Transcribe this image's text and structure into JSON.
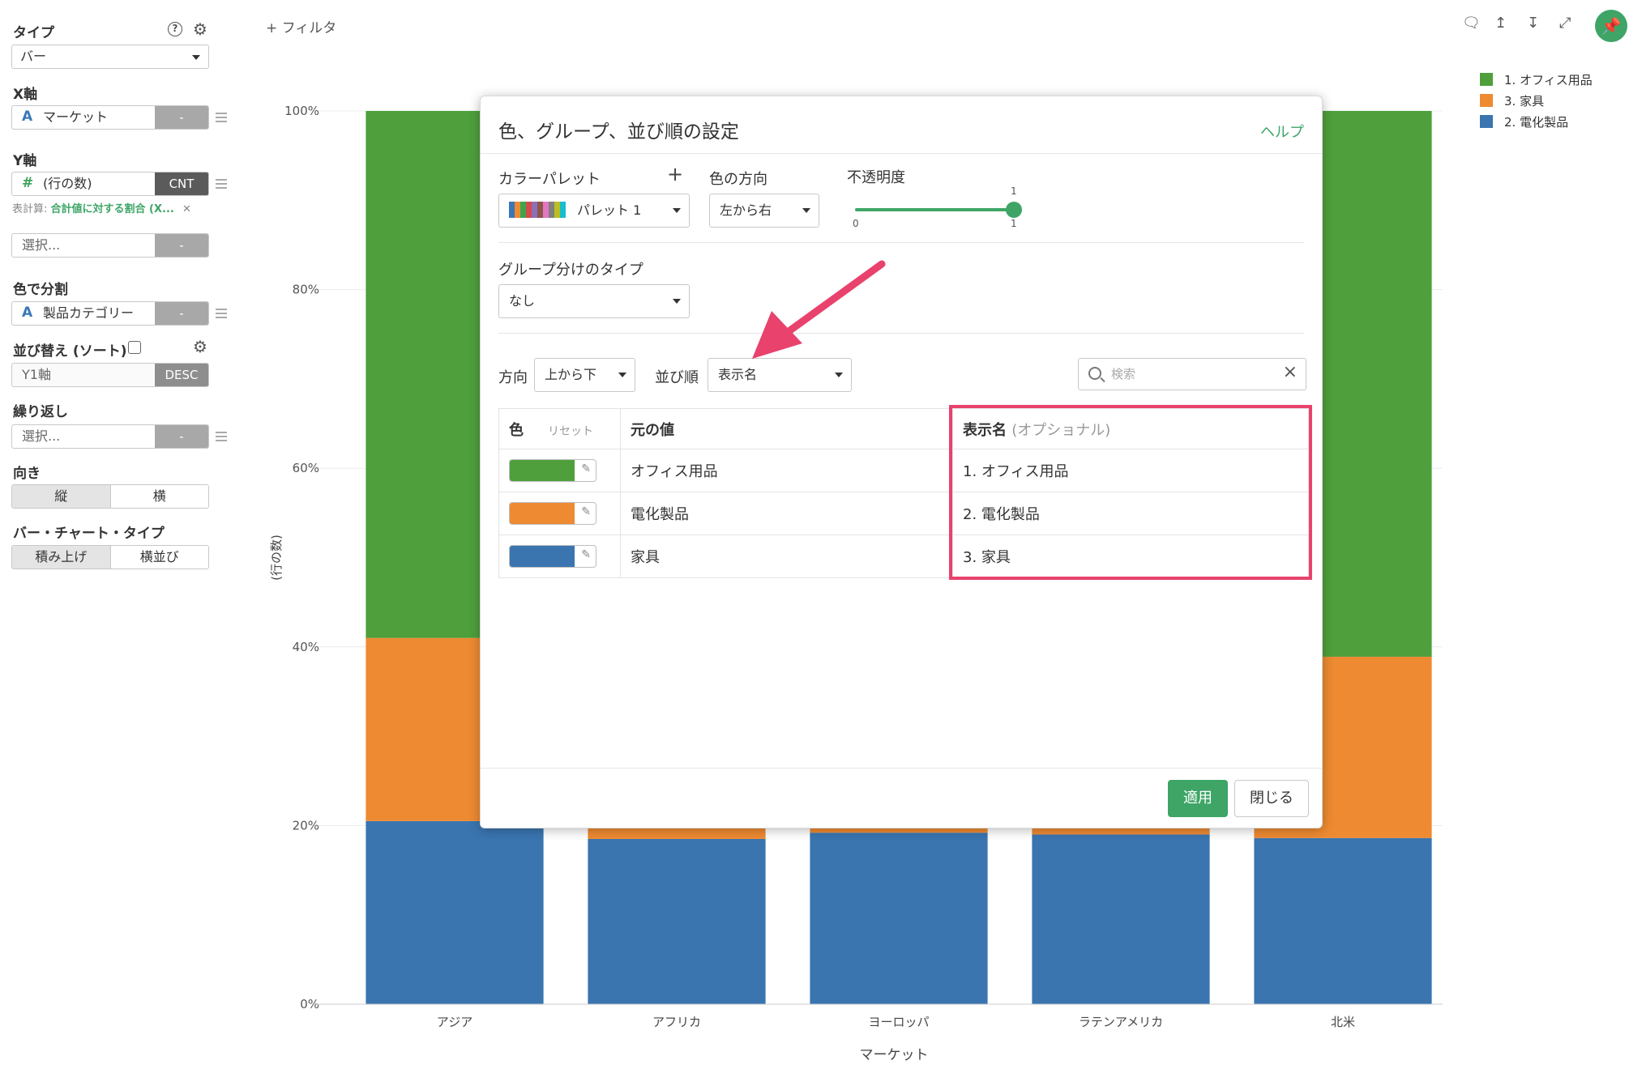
{
  "sidebar": {
    "type_label": "タイプ",
    "type_value": "バー",
    "x_label": "X軸",
    "x_field": {
      "type": "A",
      "name": "マーケット",
      "btn": "-"
    },
    "y_label": "Y軸",
    "y_field": {
      "type": "#",
      "name": "(行の数)",
      "btn": "CNT"
    },
    "table_calc_prefix": "表計算:",
    "table_calc_value": "合計値に対する割合 (X...",
    "y2_placeholder": "選択...",
    "y2_btn": "-",
    "color_label": "色で分割",
    "color_field": {
      "type": "A",
      "name": "製品カテゴリー",
      "btn": "-"
    },
    "sort_label": "並び替え (ソート)",
    "sort_field": {
      "name": "Y1軸",
      "btn": "DESC"
    },
    "repeat_label": "繰り返し",
    "repeat_placeholder": "選択...",
    "repeat_btn": "-",
    "orientation_label": "向き",
    "orientation_options": [
      "縦",
      "横"
    ],
    "bartype_label": "バー・チャート・タイプ",
    "bartype_options": [
      "積み上げ",
      "横並び"
    ]
  },
  "toolbar": {
    "filter_label": "+ フィルタ",
    "icons": [
      "comment-icon",
      "upload-icon",
      "download-icon",
      "expand-icon",
      "pin-icon"
    ]
  },
  "legend": [
    {
      "label": "1. オフィス用品",
      "color": "#4f9f3c"
    },
    {
      "label": "3. 家具",
      "color": "#ee8a32"
    },
    {
      "label": "2. 電化製品",
      "color": "#3a75b0"
    }
  ],
  "chart_data": {
    "type": "bar",
    "stacked": true,
    "categories": [
      "アジア",
      "アフリカ",
      "ヨーロッパ",
      "ラテンアメリカ",
      "北米"
    ],
    "series": [
      {
        "name": "2. 電化製品",
        "color": "#3a75b0",
        "values": [
          20.5,
          18.5,
          19.2,
          19.0,
          18.6
        ]
      },
      {
        "name": "3. 家具",
        "color": "#ee8a32",
        "values": [
          20.5,
          20.0,
          20.2,
          20.5,
          20.3
        ]
      },
      {
        "name": "1. オフィス用品",
        "color": "#4f9f3c",
        "values": [
          59.0,
          61.5,
          60.6,
          60.5,
          61.1
        ]
      }
    ],
    "xlabel": "マーケット",
    "ylabel": "(行の数)",
    "ylim": [
      0,
      100
    ],
    "yticks": [
      0,
      20,
      40,
      60,
      80,
      100
    ],
    "ytick_labels": [
      "0%",
      "20%",
      "40%",
      "60%",
      "80%",
      "100%"
    ],
    "grid": true
  },
  "modal": {
    "title": "色、グループ、並び順の設定",
    "help": "ヘルプ",
    "palette_label": "カラーパレット",
    "palette_value": "パレット 1",
    "color_dir_label": "色の方向",
    "color_dir_value": "左から右",
    "opacity_label": "不透明度",
    "opacity_value": "1",
    "opacity_min": "0",
    "opacity_max": "1",
    "opacity_fraction": 1.0,
    "group_type_label": "グループ分けのタイプ",
    "group_type_value": "なし",
    "direction_label": "方向",
    "direction_value": "上から下",
    "order_label": "並び順",
    "order_value": "表示名",
    "search_placeholder": "検索",
    "table": {
      "col_color": "色",
      "col_reset": "リセット",
      "col_original": "元の値",
      "col_display": "表示名",
      "col_display_opt": "(オプショナル)",
      "rows": [
        {
          "color": "#4f9f3c",
          "original": "オフィス用品",
          "display": "1. オフィス用品"
        },
        {
          "color": "#ee8a32",
          "original": "電化製品",
          "display": "2. 電化製品"
        },
        {
          "color": "#3a75b0",
          "original": "家具",
          "display": "3. 家具"
        }
      ]
    },
    "apply_label": "適用",
    "close_label": "閉じる"
  },
  "annotation": {
    "arrow_color": "#e8426d",
    "highlight_color": "#e8426d"
  }
}
